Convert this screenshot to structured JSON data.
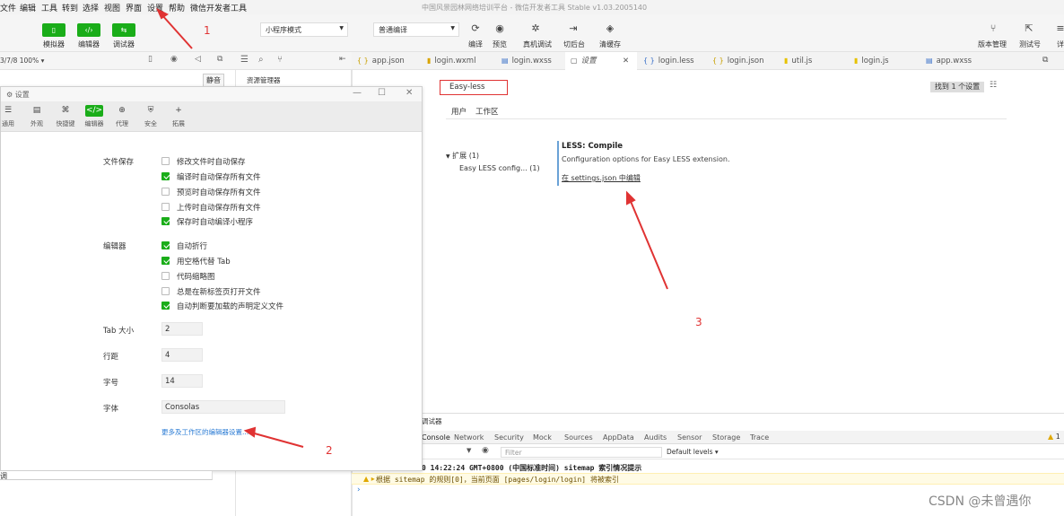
{
  "app_title": "中国风景园林网络培训平台 - 微信开发者工具 Stable v1.03.2005140",
  "menu": [
    "文件",
    "编辑",
    "工具",
    "转到",
    "选择",
    "视图",
    "界面",
    "设置",
    "帮助",
    "微信开发者工具"
  ],
  "toolbar": {
    "simulator": "模拟器",
    "editor": "编辑器",
    "debugger": "调试器",
    "mode_select": "小程序模式",
    "compile_select": "普通编译",
    "compile": "编译",
    "preview": "预览",
    "real_debug": "真机调试",
    "background": "切后台",
    "clear_cache": "清缓存",
    "version": "版本管理",
    "test_number": "测试号",
    "details": "详"
  },
  "sim_header": {
    "device": "3/7/8 100% ▾"
  },
  "tooltip": "静音",
  "explorer": {
    "title": "资源管理器"
  },
  "tabs": [
    {
      "icon": "{ }",
      "label": "app.json"
    },
    {
      "icon": "▮",
      "label": "login.wxml"
    },
    {
      "icon": "▤",
      "label": "login.wxss"
    },
    {
      "icon": "▢",
      "label": "设置"
    },
    {
      "icon": "{ }",
      "label": "login.less"
    },
    {
      "icon": "{ }",
      "label": "login.json"
    },
    {
      "icon": "▮",
      "label": "util.js"
    },
    {
      "icon": "▮",
      "label": "login.js"
    },
    {
      "icon": "▤",
      "label": "app.wxss"
    }
  ],
  "settings_editor": {
    "search_value": "Easy-less",
    "found": "找到 1 个设置",
    "scope_user": "用户",
    "scope_workspace": "工作区",
    "tree_extensions": "扩展 (1)",
    "tree_easyless": "Easy LESS config... (1)",
    "setting_title": "LESS: Compile",
    "setting_desc": "Configuration options for Easy LESS extension.",
    "setting_link": "在 settings.json 中编辑"
  },
  "dialog": {
    "title": "设置",
    "tabs": [
      {
        "icon": "☰",
        "label": "通用"
      },
      {
        "icon": "▤",
        "label": "外观"
      },
      {
        "icon": "⌘",
        "label": "快捷键"
      },
      {
        "icon": "</>",
        "label": "编辑器"
      },
      {
        "icon": "⊕",
        "label": "代理"
      },
      {
        "icon": "⛨",
        "label": "安全"
      },
      {
        "icon": "+",
        "label": "拓展"
      }
    ],
    "file_save": {
      "label": "文件保存",
      "options": [
        {
          "label": "修改文件时自动保存",
          "checked": false
        },
        {
          "label": "编译时自动保存所有文件",
          "checked": true
        },
        {
          "label": "预览时自动保存所有文件",
          "checked": false
        },
        {
          "label": "上传时自动保存所有文件",
          "checked": false
        },
        {
          "label": "保存时自动编译小程序",
          "checked": true
        }
      ]
    },
    "editor": {
      "label": "编辑器",
      "options": [
        {
          "label": "自动折行",
          "checked": true
        },
        {
          "label": "用空格代替 Tab",
          "checked": true
        },
        {
          "label": "代码缩略图",
          "checked": false
        },
        {
          "label": "总是在新标签页打开文件",
          "checked": false
        },
        {
          "label": "自动判断要加载的声明定义文件",
          "checked": true
        }
      ]
    },
    "tab_size": {
      "label": "Tab 大小",
      "value": "2"
    },
    "line_height": {
      "label": "行距",
      "value": "4"
    },
    "font_size": {
      "label": "字号",
      "value": "14"
    },
    "font": {
      "label": "字体",
      "value": "Consolas"
    },
    "more_link": "更多及工作区的编辑器设置..."
  },
  "bottom_panel": {
    "title": "调试器",
    "tabs": [
      "Console",
      "Network",
      "Security",
      "Mock",
      "Sources",
      "AppData",
      "Audits",
      "Sensor",
      "Storage",
      "Trace"
    ],
    "warn_count": "1",
    "filter_placeholder": "Filter",
    "levels": "Default levels ▾",
    "log1": "0 14:22:24 GMT+0800 (中国标准时间) sitemap 索引情况提示",
    "log2": "根据 sitemap 的规则[0]，当前页面 [pages/login/login] 将被索引",
    "prompt": "›"
  },
  "bottom_left_label": "调",
  "annotations": [
    "1",
    "2",
    "3"
  ],
  "watermark": "CSDN @未曾遇你",
  "colors": {
    "accent_green": "#1aad19",
    "annotation_red": "#e03333",
    "link_blue": "#2a7bd4"
  }
}
